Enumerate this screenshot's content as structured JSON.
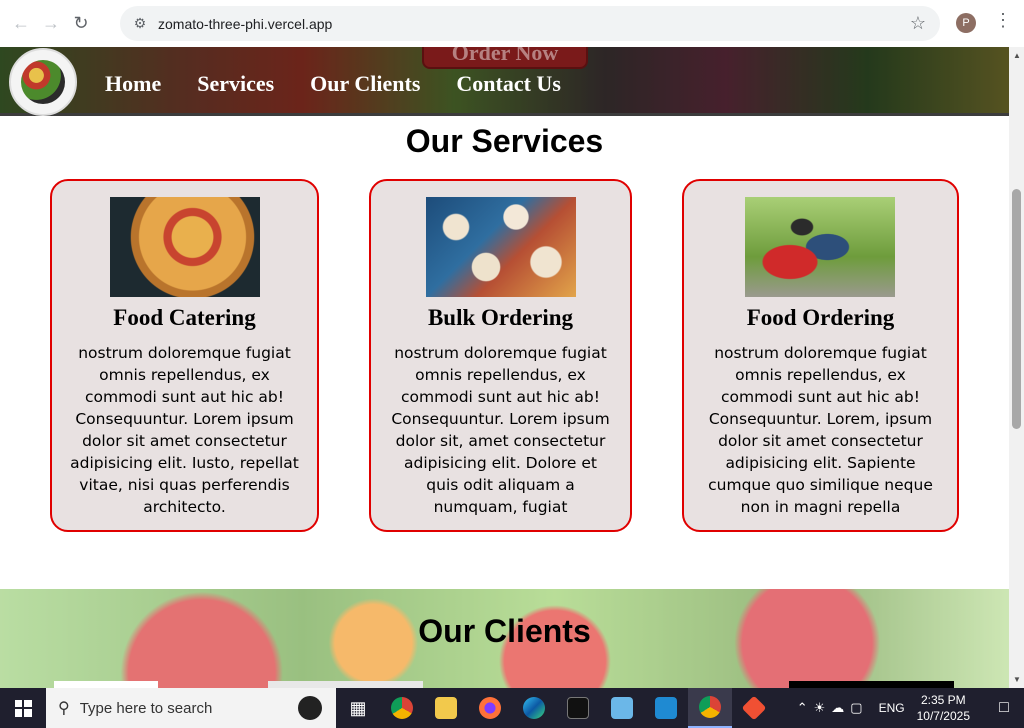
{
  "browser": {
    "url": "zomato-three-phi.vercel.app",
    "profile_initial": "P"
  },
  "site": {
    "order_button": "Order Now",
    "nav": [
      "Home",
      "Services",
      "Our Clients",
      "Contact Us"
    ]
  },
  "services": {
    "title": "Our Services",
    "cards": [
      {
        "title": "Food Catering",
        "text": "nostrum doloremque fugiat omnis repellendus, ex commodi sunt aut hic ab! Consequuntur. Lorem ipsum dolor sit amet consectetur adipisicing elit. Iusto, repellat vitae, nisi quas perferendis architecto.",
        "image": "pizza"
      },
      {
        "title": "Bulk Ordering",
        "text": "nostrum doloremque fugiat omnis repellendus, ex commodi sunt aut hic ab! Consequuntur. Lorem ipsum dolor sit, amet consectetur adipisicing elit. Dolore et quis odit aliquam a numquam, fugiat",
        "image": "table-spread"
      },
      {
        "title": "Food Ordering",
        "text": "nostrum doloremque fugiat omnis repellendus, ex commodi sunt aut hic ab! Consequuntur. Lorem, ipsum dolor sit amet consectetur adipisicing elit. Sapiente cumque quo similique neque non in magni repella",
        "image": "delivery-rider"
      }
    ]
  },
  "clients": {
    "title": "Our Clients"
  },
  "taskbar": {
    "search_placeholder": "Type here to search",
    "language": "ENG",
    "time": "2:35 PM",
    "date": "10/7/2025"
  },
  "colors": {
    "card_border": "#e00000",
    "card_background": "#e8e1e1",
    "taskbar": "#1f1f2e"
  }
}
